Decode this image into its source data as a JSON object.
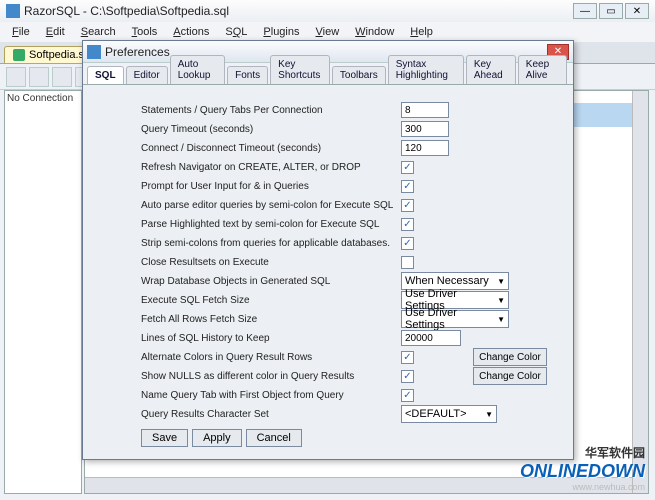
{
  "window": {
    "title": "RazorSQL - C:\\Softpedia\\Softpedia.sql",
    "tab_label": "Softpedia.sql",
    "sidebar_text": "No Connection"
  },
  "menubar": [
    "File",
    "Edit",
    "Search",
    "Tools",
    "Actions",
    "SQL",
    "Plugins",
    "View",
    "Window",
    "Help"
  ],
  "dialog": {
    "title": "Preferences",
    "tabs": [
      "SQL",
      "Editor",
      "Auto Lookup",
      "Fonts",
      "Key Shortcuts",
      "Toolbars",
      "Syntax Highlighting",
      "Key Ahead",
      "Keep Alive"
    ],
    "active_tab": 0,
    "fields": {
      "statements_label": "Statements / Query Tabs Per Connection",
      "statements_value": "8",
      "timeout_label": "Query Timeout (seconds)",
      "timeout_value": "300",
      "connect_label": "Connect / Disconnect Timeout (seconds)",
      "connect_value": "120",
      "refresh_label": "Refresh Navigator on CREATE, ALTER, or DROP",
      "refresh_checked": true,
      "prompt_label": "Prompt for User Input for & in Queries",
      "prompt_checked": true,
      "autoparse_label": "Auto parse editor queries by semi-colon for Execute SQL",
      "autoparse_checked": true,
      "parsehl_label": "Parse Highlighted text by semi-colon for Execute SQL",
      "parsehl_checked": true,
      "strip_label": "Strip semi-colons from queries for applicable databases.",
      "strip_checked": true,
      "closers_label": "Close Resultsets on Execute",
      "closers_checked": false,
      "wrap_label": "Wrap Database Objects in Generated SQL",
      "wrap_value": "When Necessary",
      "fetch_label": "Execute SQL Fetch Size",
      "fetch_value": "Use Driver Settings",
      "fetchall_label": "Fetch All Rows Fetch Size",
      "fetchall_value": "Use Driver Settings",
      "history_label": "Lines of SQL History to Keep",
      "history_value": "20000",
      "altcolor_label": "Alternate Colors in Query Result Rows",
      "altcolor_checked": true,
      "altcolor_btn": "Change Color",
      "nulls_label": "Show NULLS as different color in Query Results",
      "nulls_checked": true,
      "nulls_btn": "Change Color",
      "nametab_label": "Name Query Tab with First Object from Query",
      "nametab_checked": true,
      "charset_label": "Query Results Character Set",
      "charset_value": "<DEFAULT>"
    },
    "buttons": {
      "save": "Save",
      "apply": "Apply",
      "cancel": "Cancel"
    }
  },
  "watermark": {
    "cn": "华军软件园",
    "en": "ONLINEDOWN",
    "url": "www.newhua.com"
  }
}
